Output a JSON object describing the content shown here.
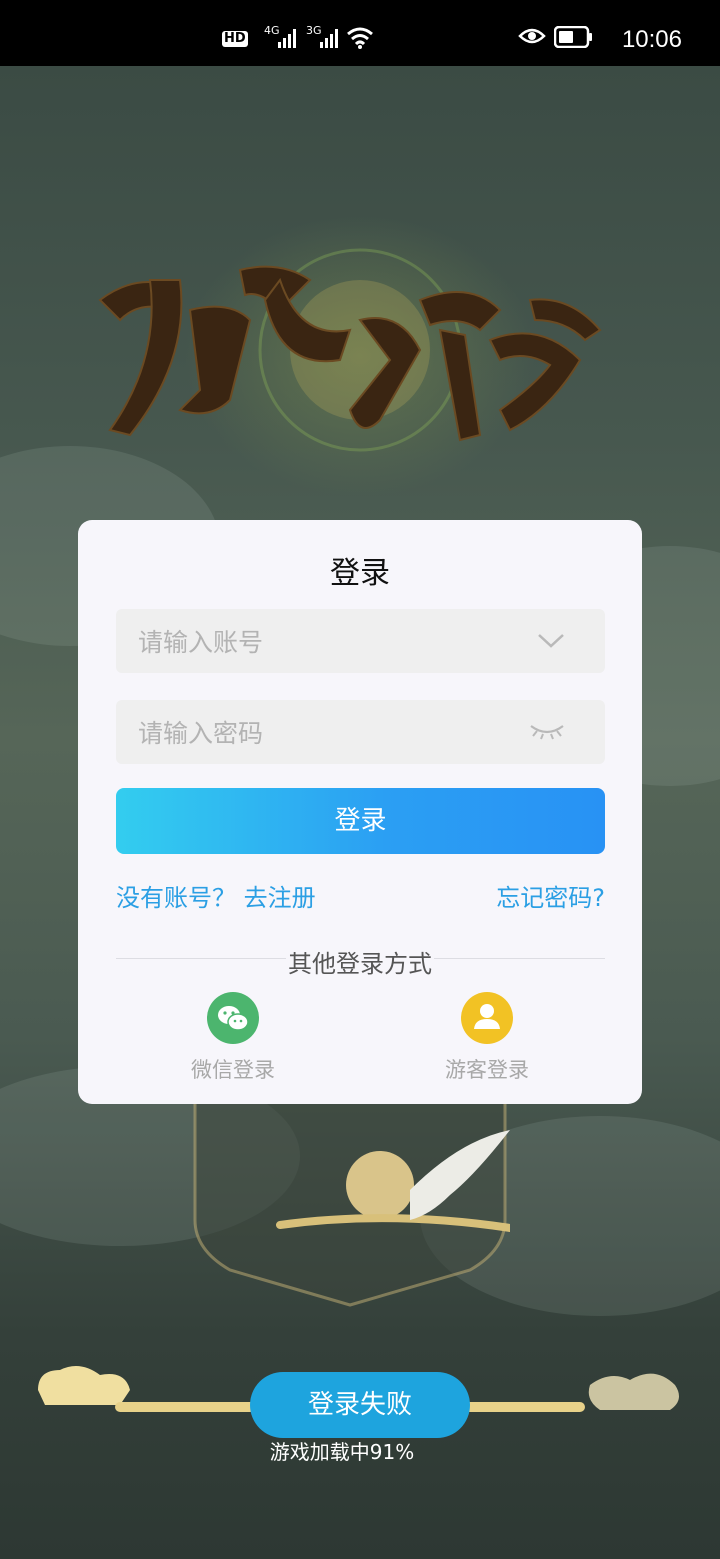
{
  "status_bar": {
    "hd_badge": "HD",
    "signal1_label": "4G",
    "signal2_label": "3G",
    "time": "10:06"
  },
  "login": {
    "title": "登录",
    "account_placeholder": "请输入账号",
    "password_placeholder": "请输入密码",
    "login_button": "登录",
    "no_account_link": "没有账号？ 去注册",
    "forgot_password_link": "忘记密码?",
    "other_methods_label": "其他登录方式",
    "wechat_label": "微信登录",
    "guest_label": "游客登录"
  },
  "loader": {
    "status_button": "登录失败",
    "progress_text": "游戏加载中91%",
    "progress_percent": 91
  },
  "colors": {
    "accent_blue": "#2b9fe4",
    "wechat_green": "#4cb56e",
    "guest_yellow": "#f2c224"
  }
}
